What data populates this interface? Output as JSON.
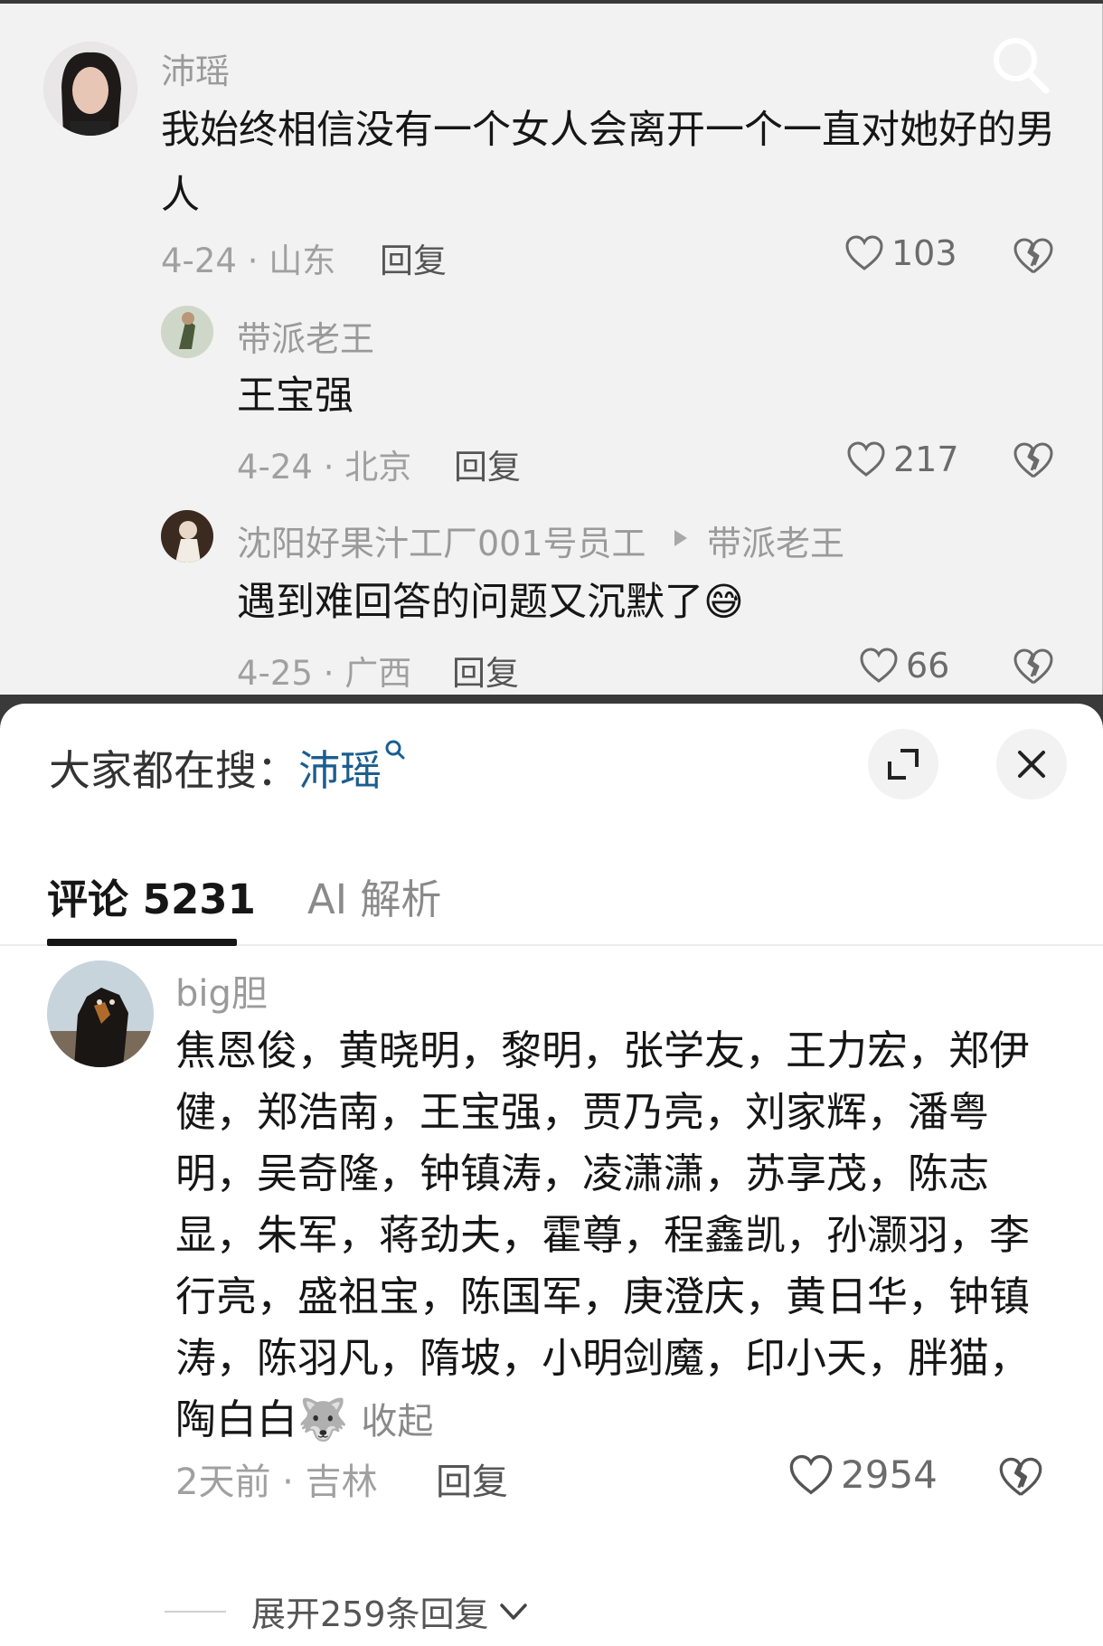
{
  "top_comments": [
    {
      "username": "沛瑶",
      "text": "我始终相信没有一个女人会离开一个一直对她好的男人",
      "meta": "4-24 · 山东",
      "reply_label": "回复",
      "likes": "103"
    },
    {
      "username": "带派老王",
      "text": "王宝强",
      "meta": "4-24 · 北京",
      "reply_label": "回复",
      "likes": "217"
    },
    {
      "username": "沈阳好果汁工厂001号员工",
      "reply_to": "带派老王",
      "text": "遇到难回答的问题又沉默了",
      "emoji": "😅",
      "meta": "4-25 · 广西",
      "reply_label": "回复",
      "likes": "66"
    }
  ],
  "sheet": {
    "hot_search_label": "大家都在搜：",
    "hot_search_term": "沛瑶",
    "tabs": [
      {
        "label": "评论 5231",
        "active": true
      },
      {
        "label": "AI 解析",
        "active": false
      }
    ]
  },
  "main_comment": {
    "username": "big胆",
    "text": "焦恩俊，黄晓明，黎明，张学友，王力宏，郑伊健，郑浩南，王宝强，贾乃亮，刘家辉，潘粤明，吴奇隆，钟镇涛，凌潇潇，苏享茂，陈志显，朱军，蒋劲夫，霍尊，程鑫凯，孙灏羽，李行亮，盛祖宝，陈国军，庚澄庆，黄日华，钟镇涛，陈羽凡，隋坡，小明剑魔，印小天，胖猫，陶白白",
    "emoji": "🐺",
    "collapse_label": "收起",
    "meta": "2天前 · 吉林",
    "reply_label": "回复",
    "likes": "2954",
    "expand_label": "展开259条回复"
  },
  "colors": {
    "link": "#1b5e8f",
    "text": "#161616",
    "muted": "#a0a0a0"
  }
}
